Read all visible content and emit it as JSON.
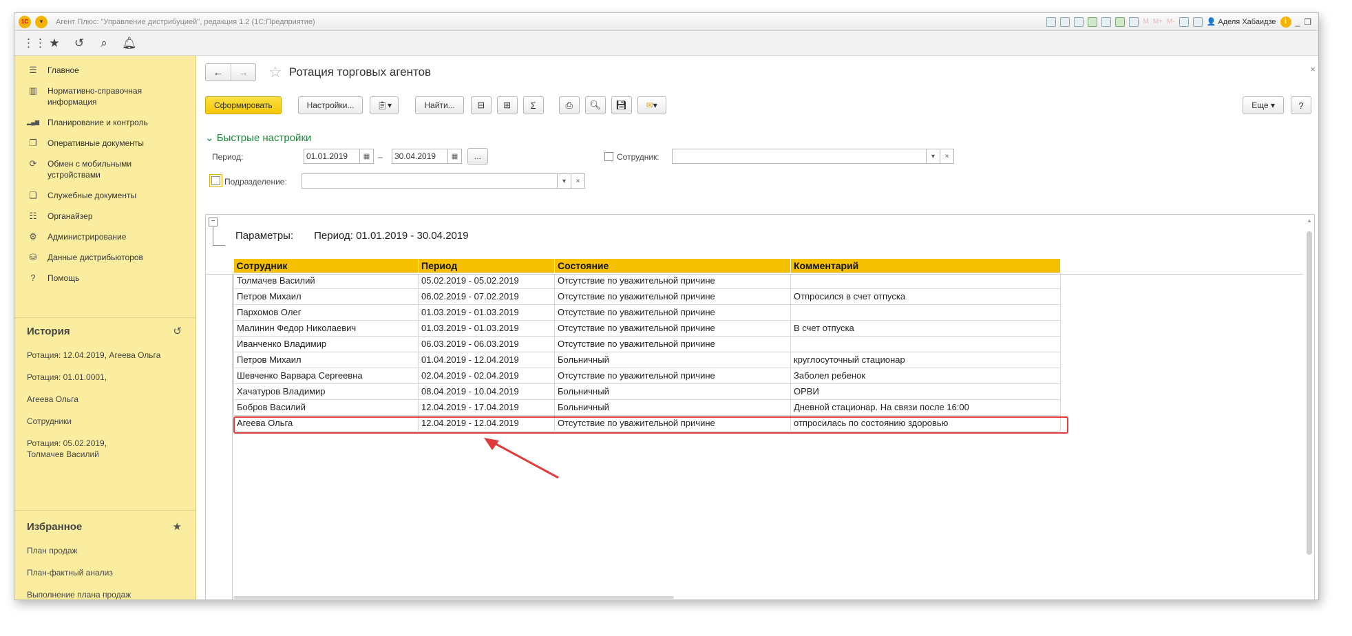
{
  "titlebar": {
    "title": "Агент Плюс: \"Управление дистрибуцией\", редакция 1.2 (1С:Предприятие)",
    "logo": "1С",
    "user": "Аделя Хабаидзе",
    "m_labels": [
      "M",
      "M+",
      "M-"
    ]
  },
  "sidebar": {
    "nav": [
      {
        "icon": "menu-lines-icon",
        "glyph": "☰",
        "label": "Главное"
      },
      {
        "icon": "grid-reference-icon",
        "glyph": "▥",
        "label": "Нормативно-справочная информация"
      },
      {
        "icon": "bar-chart-icon",
        "glyph": "▂▄▆",
        "label": "Планирование и контроль"
      },
      {
        "icon": "documents-icon",
        "glyph": "❐",
        "label": "Оперативные документы"
      },
      {
        "icon": "sync-icon",
        "glyph": "⟳",
        "label": "Обмен с мобильными устройствами"
      },
      {
        "icon": "service-docs-icon",
        "glyph": "❏",
        "label": "Служебные документы"
      },
      {
        "icon": "organizer-icon",
        "glyph": "☷",
        "label": "Органайзер"
      },
      {
        "icon": "gear-icon",
        "glyph": "⚙",
        "label": "Администрирование"
      },
      {
        "icon": "distributor-data-icon",
        "glyph": "⛁",
        "label": "Данные дистрибьюторов"
      },
      {
        "icon": "help-icon",
        "glyph": "?",
        "label": "Помощь"
      }
    ],
    "history": {
      "title": "История",
      "items": [
        "Ротация: 12.04.2019, Агеева Ольга",
        "Ротация: 01.01.0001,",
        "Агеева Ольга",
        "Сотрудники",
        "Ротация: 05.02.2019, Толмачев Василий"
      ]
    },
    "favorites": {
      "title": "Избранное",
      "items": [
        "План продаж",
        "План-фактный анализ",
        "Выполнение плана продаж"
      ]
    }
  },
  "form": {
    "title": "Ротация торговых агентов",
    "buttons": {
      "generate": "Сформировать",
      "settings": "Настройки...",
      "find": "Найти...",
      "more": "Еще",
      "help": "?"
    },
    "quick_settings": "Быстрые настройки",
    "period_label": "Период:",
    "period_from": "01.01.2019",
    "period_dash": "–",
    "period_to": "30.04.2019",
    "period_more": "...",
    "employee_label": "Сотрудник:",
    "employee_value": "",
    "department_label": "Подразделение:",
    "department_value": ""
  },
  "report": {
    "params_label": "Параметры:",
    "params_value": "Период: 01.01.2019 - 30.04.2019",
    "columns": [
      "Сотрудник",
      "Период",
      "Состояние",
      "Комментарий"
    ],
    "rows": [
      [
        "Толмачев Василий",
        "05.02.2019 - 05.02.2019",
        "Отсутствие по уважительной причине",
        ""
      ],
      [
        "Петров Михаил",
        "06.02.2019 - 07.02.2019",
        "Отсутствие по уважительной причине",
        "Отпросился в счет отпуска"
      ],
      [
        "Пархомов Олег",
        "01.03.2019 - 01.03.2019",
        "Отсутствие по уважительной причине",
        ""
      ],
      [
        "Малинин Федор Николаевич",
        "01.03.2019 - 01.03.2019",
        "Отсутствие по уважительной причине",
        "В счет отпуска"
      ],
      [
        "Иванченко Владимир",
        "06.03.2019 - 06.03.2019",
        "Отсутствие по уважительной причине",
        ""
      ],
      [
        "Петров Михаил",
        "01.04.2019 - 12.04.2019",
        "Больничный",
        "круглосуточный стационар"
      ],
      [
        "Шевченко Варвара Сергеевна",
        "02.04.2019 - 02.04.2019",
        "Отсутствие по уважительной причине",
        "Заболел ребенок"
      ],
      [
        "Хачатуров Владимир",
        "08.04.2019 - 10.04.2019",
        "Больничный",
        "ОРВИ"
      ],
      [
        "Бобров Василий",
        "12.04.2019 - 17.04.2019",
        "Больничный",
        "Дневной стационар. На связи после 16:00"
      ],
      [
        "Агеева Ольга",
        "12.04.2019 - 12.04.2019",
        "Отсутствие по уважительной причине",
        "отпросилась по состоянию здоровью"
      ]
    ],
    "highlighted_row": 9
  },
  "colors": {
    "sidebar_bg": "#fbeda0",
    "header_bg": "#f5c000",
    "primary_button": "#f5c800",
    "highlight": "#e03b3b",
    "quick_settings": "#1a8a3a"
  }
}
